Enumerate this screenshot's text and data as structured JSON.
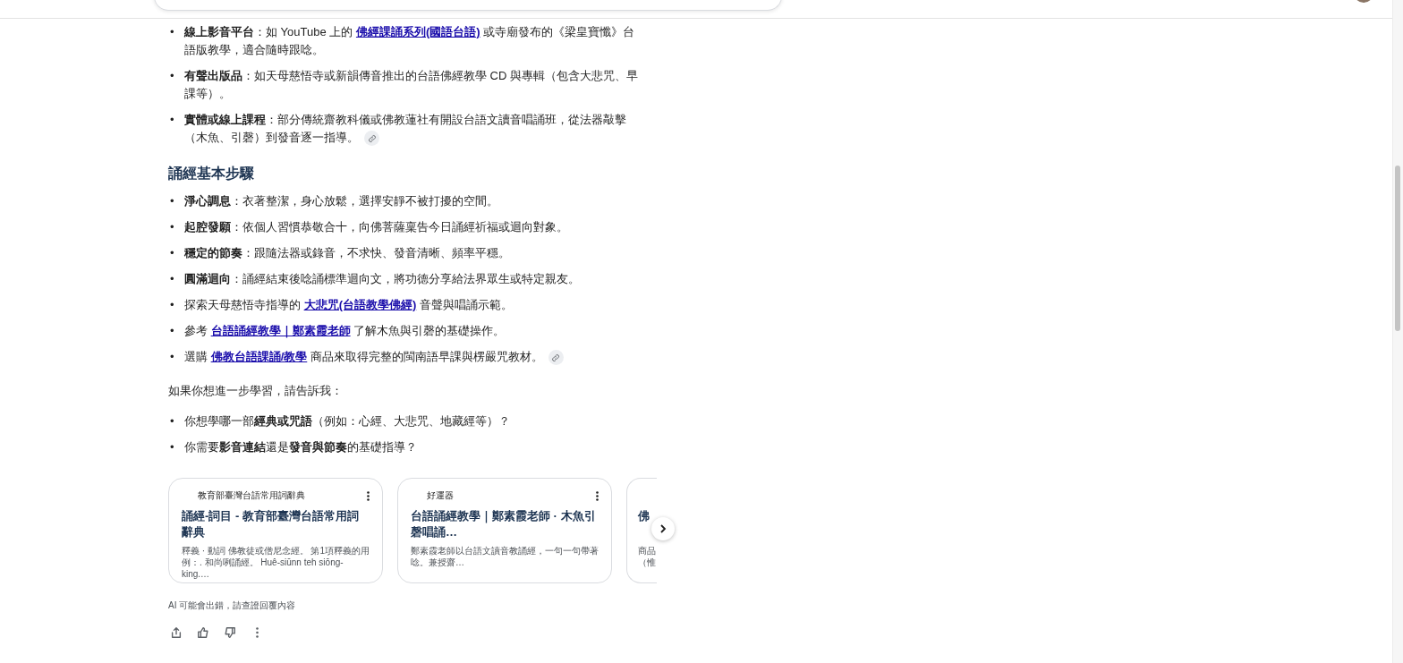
{
  "list_a": [
    {
      "parts": [
        {
          "kind": "text",
          "text": "**線上影音平台**：如 YouTube 上的 "
        },
        {
          "kind": "link",
          "text": "佛經課誦系列(國語台語)"
        },
        {
          "kind": "text",
          "text": " 或寺廟發布的《梁皇寶懺》台語版教學，適合隨時跟唸。"
        }
      ],
      "source_chip": false
    },
    {
      "parts": [
        {
          "kind": "text",
          "text": "**有聲出版品**：如天母慈悟寺或新韻傳音推出的台語佛經教學 CD 與專輯（包含大悲咒、早課等）。"
        }
      ],
      "source_chip": false
    },
    {
      "parts": [
        {
          "kind": "text",
          "text": "**實體或線上課程**：部分傳統齋教科儀或佛教蓮社有開設台語文讀音唱誦班，從法器敲擊（木魚、引磬）到發音逐一指導。"
        }
      ],
      "source_chip": true
    }
  ],
  "heading": "誦經基本步驟",
  "list_b": [
    {
      "parts": [
        {
          "kind": "text",
          "text": "**淨心調息**：衣著整潔，身心放鬆，選擇安靜不被打擾的空間。"
        }
      ],
      "source_chip": false
    },
    {
      "parts": [
        {
          "kind": "text",
          "text": "**起腔發願**：依個人習慣恭敬合十，向佛菩薩稟告今日誦經祈福或迴向對象。"
        }
      ],
      "source_chip": false
    },
    {
      "parts": [
        {
          "kind": "text",
          "text": "**穩定的節奏**：跟隨法器或錄音，不求快、發音清晰、頻率平穩。"
        }
      ],
      "source_chip": false
    },
    {
      "parts": [
        {
          "kind": "text",
          "text": "**圓滿迴向**：誦經結束後唸誦標準迴向文，將功德分享給法界眾生或特定親友。"
        }
      ],
      "source_chip": false
    },
    {
      "parts": [
        {
          "kind": "text",
          "text": "探索天母慈悟寺指導的 "
        },
        {
          "kind": "link",
          "text": "大悲咒(台語教學佛經)"
        },
        {
          "kind": "text",
          "text": " 音聲與唱誦示範。"
        }
      ],
      "source_chip": false
    },
    {
      "parts": [
        {
          "kind": "text",
          "text": "參考 "
        },
        {
          "kind": "link",
          "text": "台語誦經教學｜鄭素霞老師"
        },
        {
          "kind": "text",
          "text": " 了解木魚與引磬的基礎操作。"
        }
      ],
      "source_chip": false
    },
    {
      "parts": [
        {
          "kind": "text",
          "text": "選購 "
        },
        {
          "kind": "link",
          "text": "佛教台語課誦/教學"
        },
        {
          "kind": "text",
          "text": " 商品來取得完整的閩南語早課與楞嚴咒教材。"
        }
      ],
      "source_chip": true
    }
  ],
  "followup_intro": "如果你想進一步學習，請告訴我：",
  "list_c": [
    {
      "parts": [
        {
          "kind": "text",
          "text": "你想學哪一部**經典或咒語**（例如：心經、大悲咒、地藏經等）？"
        }
      ],
      "source_chip": false
    },
    {
      "parts": [
        {
          "kind": "text",
          "text": "你需要**影音連結**還是**發音與節奏**的基礎指導？"
        }
      ],
      "source_chip": false
    }
  ],
  "source_cards": [
    {
      "source": "教育部臺灣台語常用詞辭典",
      "title": "誦經-詞目 - 教育部臺灣台語常用詞辭典",
      "snippet": "釋義 · 動詞 佛教徒或僧尼念經。 第1項釋義的用例：. 和尚咧誦經。 Huê-siūnn teh siōng-king.…"
    },
    {
      "source": "好運器",
      "title": "台語誦經教學｜鄭素霞老師 · 木魚引磬唱誦…",
      "snippet": "鄭素霞老師以台語文讀音教誦經，一句一句帶著唸。兼授齋…"
    },
    {
      "title": "佛",
      "snippet": "商品（惟"
    }
  ],
  "bullet": "•",
  "disclaimer": "AI 可能會出錯，請查證回覆內容"
}
